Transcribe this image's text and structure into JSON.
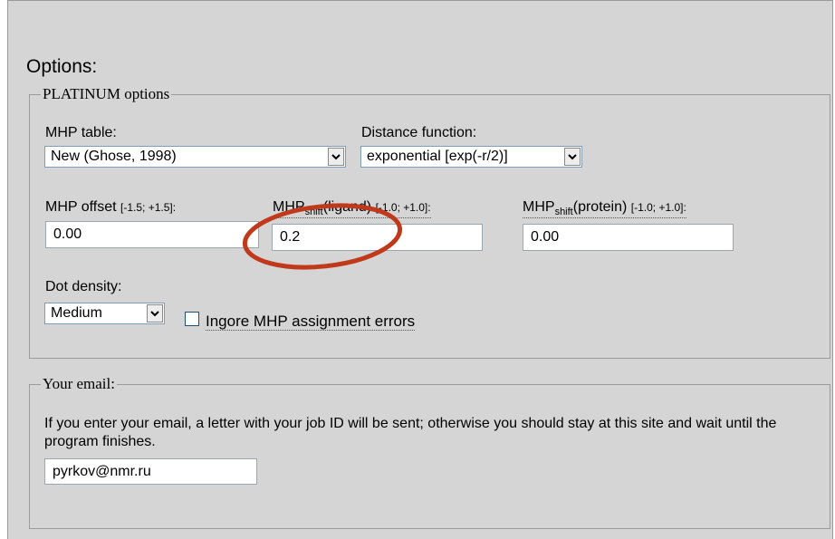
{
  "options": {
    "heading": "Options:",
    "platinum": {
      "legend": "PLATINUM options",
      "mhp_table": {
        "label": "MHP table:",
        "selected": "New (Ghose, 1998)"
      },
      "distance_function": {
        "label": "Distance function:",
        "selected": "exponential [exp(-r/2)]"
      },
      "mhp_offset": {
        "label": "MHP offset",
        "range": "[-1.5;  +1.5]:",
        "value": "0.00"
      },
      "mhp_shift_ligand": {
        "label_main": "MHP",
        "label_sub": "shift",
        "label_tail": "(ligand)",
        "range": "[-1.0;  +1.0]:",
        "value": "0.2"
      },
      "mhp_shift_protein": {
        "label_main": "MHP",
        "label_sub": "shift",
        "label_tail": "(protein)",
        "range": "[-1.0;  +1.0]:",
        "value": "0.00"
      },
      "dot_density": {
        "label": "Dot density:",
        "selected": "Medium"
      },
      "ignore_errors": {
        "label": "Ingore MHP assignment errors",
        "checked": false
      }
    },
    "email": {
      "legend": "Your email:",
      "description": "If you enter your email, a letter with your job ID will be sent; otherwise you should stay at this site and wait until the program finishes.",
      "value": "pyrkov@nmr.ru"
    }
  },
  "colors": {
    "panel_bg": "#d5d5d5",
    "highlight_ring": "#c0391b"
  }
}
